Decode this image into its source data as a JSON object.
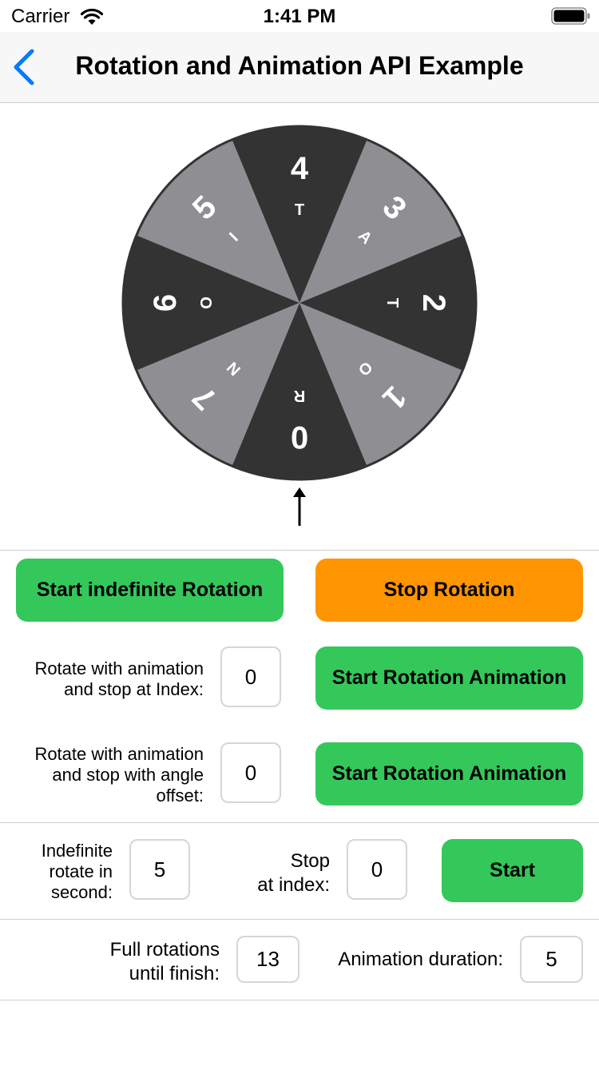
{
  "status_bar": {
    "carrier": "Carrier",
    "time": "1:41 PM"
  },
  "nav": {
    "title": "Rotation and Animation API Example"
  },
  "colors": {
    "accent": "#007aff",
    "green": "#34c85a",
    "orange": "#ff9500",
    "wheel_dark": "#333333",
    "wheel_light": "#8e8e93"
  },
  "wheel": {
    "segments": [
      {
        "number": "0",
        "letter": "R",
        "shade": "dark"
      },
      {
        "number": "1",
        "letter": "O",
        "shade": "light"
      },
      {
        "number": "2",
        "letter": "T",
        "shade": "dark"
      },
      {
        "number": "3",
        "letter": "A",
        "shade": "light"
      },
      {
        "number": "4",
        "letter": "T",
        "shade": "dark"
      },
      {
        "number": "5",
        "letter": "I",
        "shade": "light"
      },
      {
        "number": "6",
        "letter": "O",
        "shade": "dark"
      },
      {
        "number": "7",
        "letter": "N",
        "shade": "light"
      }
    ]
  },
  "controls": {
    "start_indefinite": "Start indefinite Rotation",
    "stop_rotation": "Stop Rotation",
    "index_label_line1": "Rotate with animation",
    "index_label_line2": "and stop at Index:",
    "index_value": "0",
    "start_anim_1": "Start Rotation Animation",
    "angle_label_line1": "Rotate with animation",
    "angle_label_line2": "and stop with angle",
    "angle_label_line3": "offset:",
    "angle_value": "0",
    "start_anim_2": "Start Rotation Animation",
    "indef_label_line1": "Indefinite",
    "indef_label_line2": "rotate in",
    "indef_label_line3": "second:",
    "indef_value": "5",
    "stop_label_line1": "Stop",
    "stop_label_line2": "at index:",
    "stop_index_value": "0",
    "start_label": "Start",
    "full_label_line1": "Full rotations",
    "full_label_line2": "until finish:",
    "full_value": "13",
    "duration_label": "Animation duration:",
    "duration_value": "5"
  }
}
